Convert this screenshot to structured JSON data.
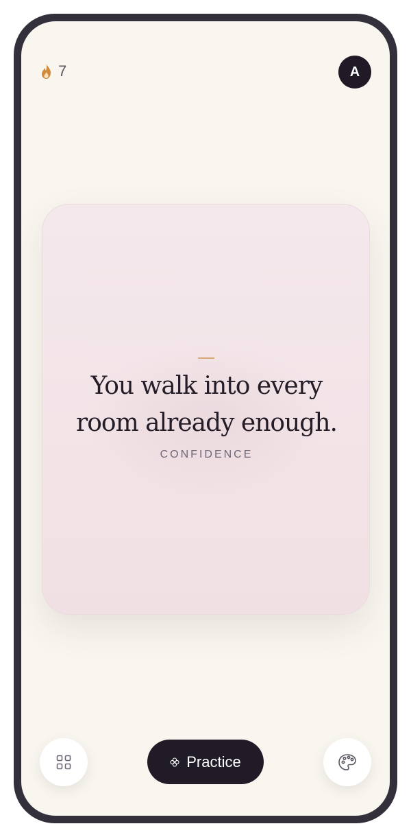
{
  "streak": {
    "icon": "flame-icon",
    "count": "7"
  },
  "profile": {
    "initial": "A"
  },
  "card": {
    "affirmation_line1": "You walk into every",
    "affirmation_line2": "room already enough.",
    "category": "CONFIDENCE"
  },
  "bottom_bar": {
    "left_icon": "grid-icon",
    "practice_label": "Practice",
    "practice_icon": "breath-icon",
    "right_icon": "palette-icon"
  },
  "colors": {
    "frame": "#34303b",
    "background": "#f9f6f0",
    "card_top": "#f4e8ec",
    "card_bottom": "#f1e0e3",
    "accent": "#d9a77a",
    "dark": "#211b27",
    "flame": "#d08a3a"
  }
}
